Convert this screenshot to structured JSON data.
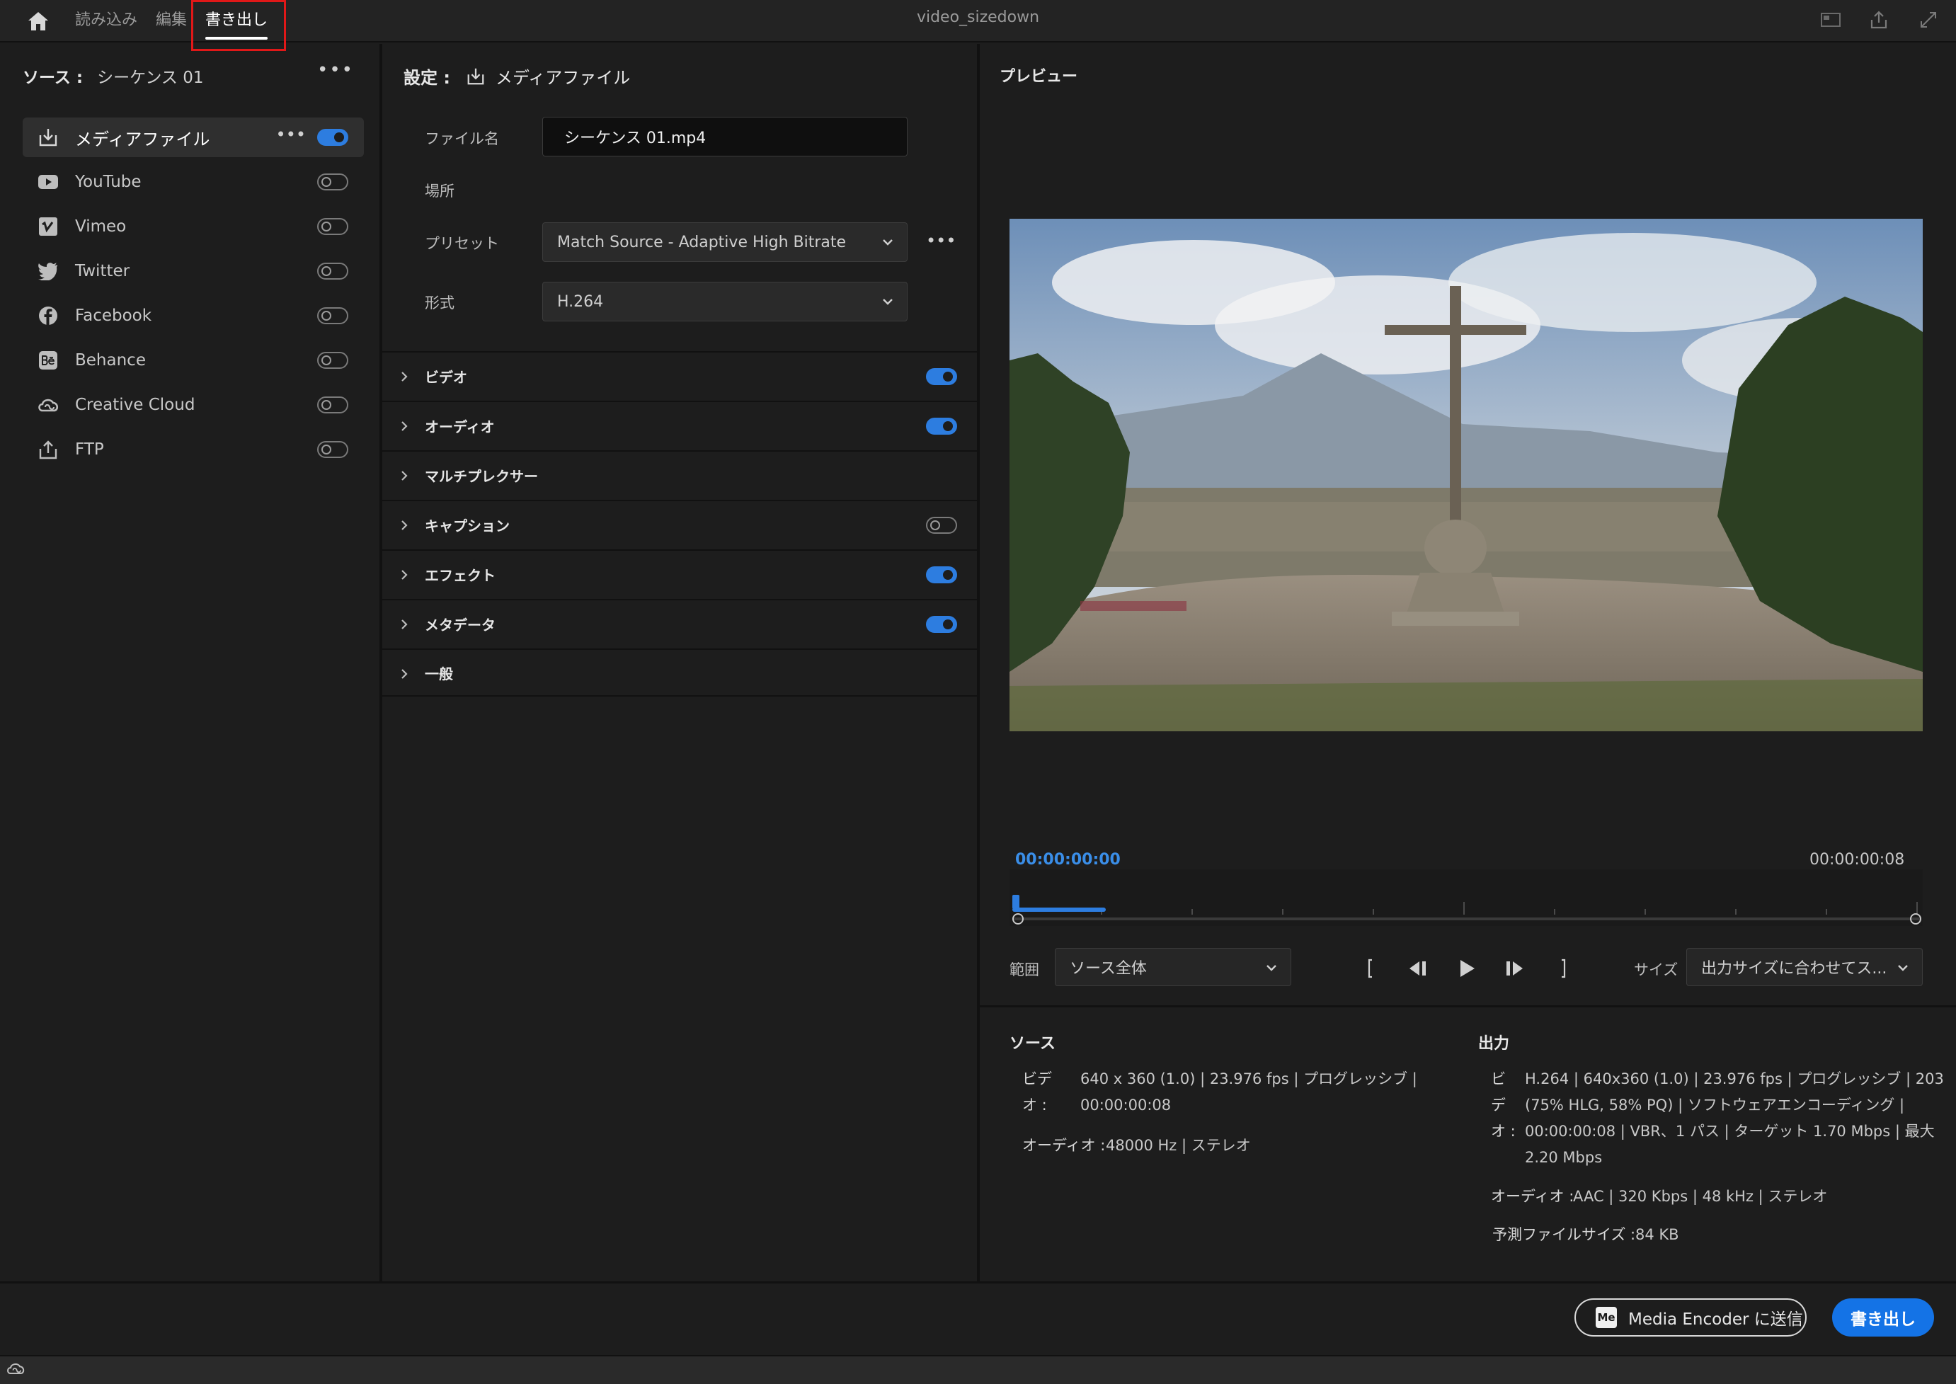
{
  "window_title": "video_sizedown",
  "nav": {
    "tab_import": "読み込み",
    "tab_edit": "編集",
    "tab_export": "書き出し"
  },
  "source": {
    "label": "ソース :",
    "value": "シーケンス 01"
  },
  "destinations": [
    {
      "label": "メディアファイル",
      "icon": "download-icon",
      "enabled": true,
      "active": true
    },
    {
      "label": "YouTube",
      "icon": "youtube-icon",
      "enabled": false
    },
    {
      "label": "Vimeo",
      "icon": "vimeo-icon",
      "enabled": false
    },
    {
      "label": "Twitter",
      "icon": "twitter-icon",
      "enabled": false
    },
    {
      "label": "Facebook",
      "icon": "facebook-icon",
      "enabled": false
    },
    {
      "label": "Behance",
      "icon": "behance-icon",
      "enabled": false
    },
    {
      "label": "Creative Cloud",
      "icon": "creative-cloud-icon",
      "enabled": false
    },
    {
      "label": "FTP",
      "icon": "ftp-upload-icon",
      "enabled": false
    }
  ],
  "settings": {
    "label": "設定 :",
    "target": "メディアファイル",
    "filename_label": "ファイル名",
    "filename_value": "シーケンス 01.mp4",
    "location_label": "場所",
    "preset_label": "プリセット",
    "preset_value": "Match Source - Adaptive High Bitrate",
    "format_label": "形式",
    "format_value": "H.264"
  },
  "sections": [
    {
      "title": "ビデオ",
      "has_toggle": true,
      "enabled": true
    },
    {
      "title": "オーディオ",
      "has_toggle": true,
      "enabled": true
    },
    {
      "title": "マルチプレクサー",
      "has_toggle": false
    },
    {
      "title": "キャプション",
      "has_toggle": true,
      "enabled": false
    },
    {
      "title": "エフェクト",
      "has_toggle": true,
      "enabled": true
    },
    {
      "title": "メタデータ",
      "has_toggle": true,
      "enabled": true
    },
    {
      "title": "一般",
      "has_toggle": false
    }
  ],
  "preview": {
    "label": "プレビュー",
    "timecode_current": "00:00:00:00",
    "timecode_end": "00:00:00:08",
    "playhead_fraction": 0,
    "range_label": "範囲",
    "range_value": "ソース全体",
    "size_label": "サイズ",
    "size_value": "出力サイズに合わせてス..."
  },
  "source_info": {
    "title": "ソース",
    "video_key_line1": "ビデ",
    "video_key_line2": "オ :",
    "video_line1": "640 x 360 (1.0)  |  23.976 fps  |  プログレッシブ  |",
    "video_line2": "00:00:00:08",
    "audio_key": "オーディオ :",
    "audio_value": "48000 Hz  |  ステレオ"
  },
  "output_info": {
    "title": "出力",
    "video_key_l1": "ビ",
    "video_key_l2": "デ",
    "video_key_l3": "オ :",
    "video_line1": "H.264  |  640x360 (1.0)  |  23.976 fps  |  プログレッシブ  |  203",
    "video_line2": "(75% HLG, 58% PQ)  |  ソフトウェアエンコーディング  |",
    "video_line3": "00:00:00:08  |  VBR、1 パス  |  ターゲット 1.70 Mbps  |  最大",
    "video_line4": "2.20 Mbps",
    "audio_key": "オーディオ :",
    "audio_value": "AAC  |  320 Kbps  |  48 kHz  |  ステレオ",
    "size_key": "予測ファイルサイズ :",
    "size_value": "84 KB"
  },
  "buttons": {
    "media_encoder_badge": "Me",
    "media_encoder": "Media Encoder に送信",
    "export": "書き出し"
  },
  "colors": {
    "accent": "#1473e6",
    "toggle_on": "#2d7de0",
    "highlight_box": "#e01818"
  }
}
